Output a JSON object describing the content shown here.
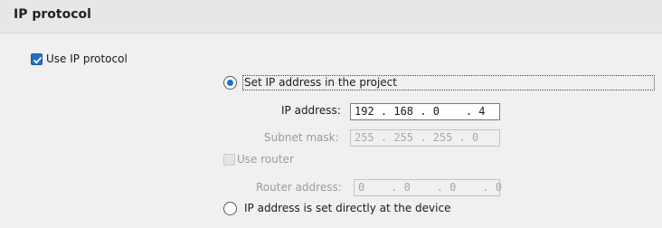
{
  "section": {
    "title": "IP protocol"
  },
  "use_ip_protocol": {
    "label": "Use IP protocol",
    "checked": true
  },
  "options": {
    "set_in_project": {
      "label": "Set IP address in the project",
      "selected": true
    },
    "set_at_device": {
      "label": "IP address is set directly at the device",
      "selected": false
    }
  },
  "fields": {
    "ip_address": {
      "label": "IP address:",
      "value": "192 . 168 . 0    . 4",
      "enabled": true
    },
    "subnet_mask": {
      "label": "Subnet mask:",
      "value": "255 . 255 . 255 . 0",
      "enabled": false
    },
    "use_router": {
      "label": "Use router",
      "checked": false,
      "enabled": false
    },
    "router_address": {
      "label": "Router address:",
      "value": "0    . 0    . 0    . 0",
      "enabled": false
    }
  },
  "colors": {
    "accent": "#1f6fc6",
    "header_background": "#e6e7e9",
    "panel_background": "#f0f0f0",
    "disabled_text": "#9a9a9a"
  }
}
